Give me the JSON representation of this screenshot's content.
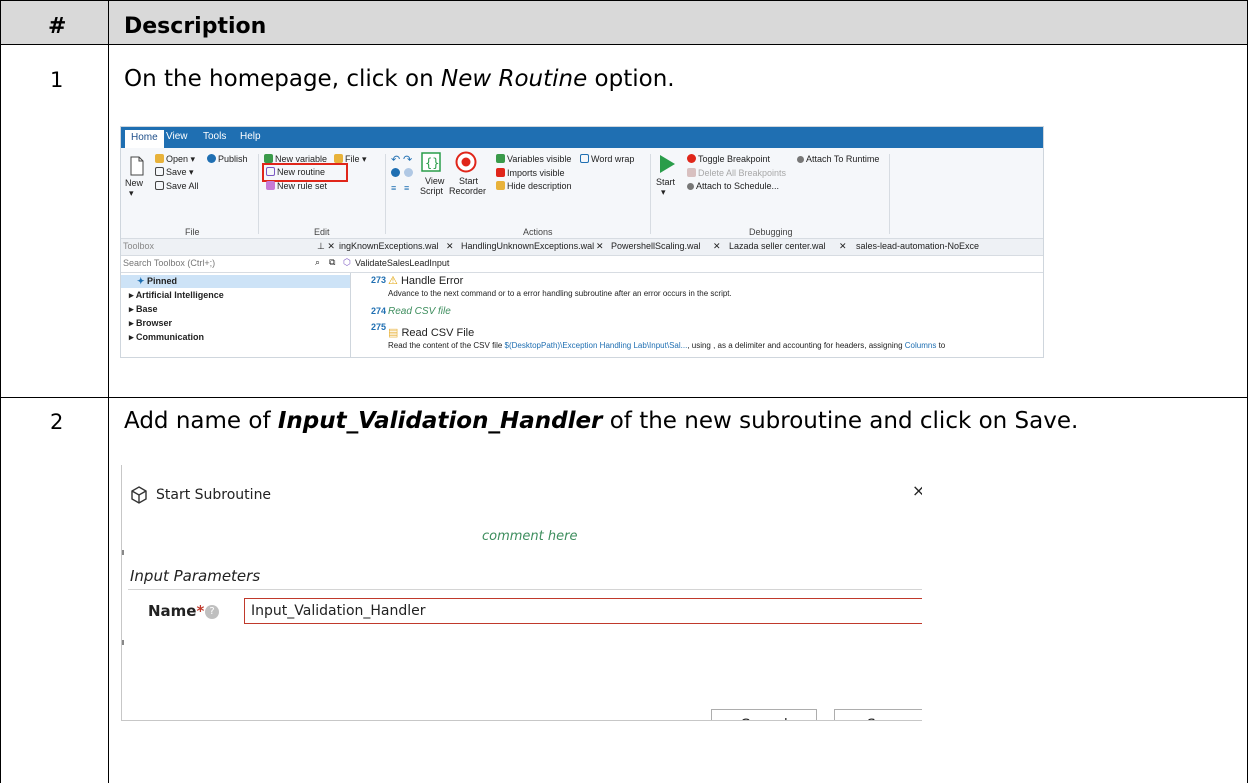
{
  "table": {
    "header_num": "#",
    "header_desc": "Description",
    "rows": [
      {
        "num": "1",
        "pre": "On the homepage, click on ",
        "emph": "New Routine",
        "post": " option."
      },
      {
        "num": "2",
        "pre": "Add name of ",
        "emph": "Input_Validation_Handler",
        "post": " of the new subroutine and click on Save."
      }
    ]
  },
  "ide": {
    "menu": [
      "Home",
      "View",
      "Tools",
      "Help"
    ],
    "file_group": {
      "new": "New",
      "open": "Open",
      "publish": "Publish",
      "save": "Save",
      "save_all": "Save All",
      "label": "File"
    },
    "edit_group": {
      "new_variable": "New variable",
      "file": "File",
      "new_routine": "New routine",
      "new_rule_set": "New rule set",
      "label": "Edit"
    },
    "actions_group": {
      "view_script_1": "View",
      "view_script_2": "Script",
      "start_recorder_1": "Start",
      "start_recorder_2": "Recorder",
      "variables_visible": "Variables visible",
      "word_wrap": "Word wrap",
      "imports_visible": "Imports visible",
      "hide_description": "Hide description",
      "label": "Actions"
    },
    "debug_group": {
      "start": "Start",
      "toggle_breakpoint": "Toggle Breakpoint",
      "delete_breakpoints": "Delete All Breakpoints",
      "attach_schedule": "Attach to Schedule...",
      "attach_runtime": "Attach To Runtime",
      "label": "Debugging"
    },
    "toolbox_title": "Toolbox",
    "tabs": [
      "ingKnownExceptions.wal",
      "HandlingUnknownExceptions.wal",
      "PowershellScaling.wal",
      "Lazada seller center.wal",
      "sales-lead-automation-NoExce"
    ],
    "search_placeholder": "Search Toolbox (Ctrl+;)",
    "subroutine_tab": "ValidateSalesLeadInput",
    "toolbox_items": [
      "Pinned",
      "Artificial Intelligence",
      "Base",
      "Browser",
      "Communication"
    ],
    "lines": [
      {
        "num": "273",
        "title": "Handle Error",
        "desc": "Advance to the next command or to a error handling subroutine after an error occurs in the script."
      },
      {
        "num": "274",
        "title": "Read CSV file"
      },
      {
        "num": "275",
        "title": "Read CSV File",
        "desc_pre": "Read the content of the CSV file ",
        "desc_path": "$(DesktopPath)\\Exception Handling Lab\\Input\\Sal...",
        "desc_mid": ", using , as a delimiter and  accounting for headers, assigning ",
        "desc_var": "Columns",
        "desc_post": " to"
      }
    ]
  },
  "dialog": {
    "title": "Start Subroutine",
    "comment": "comment here",
    "section": "Input Parameters",
    "name_label": "Name",
    "name_value": "Input_Validation_Handler",
    "cancel": "Cancel",
    "save": "Save"
  }
}
